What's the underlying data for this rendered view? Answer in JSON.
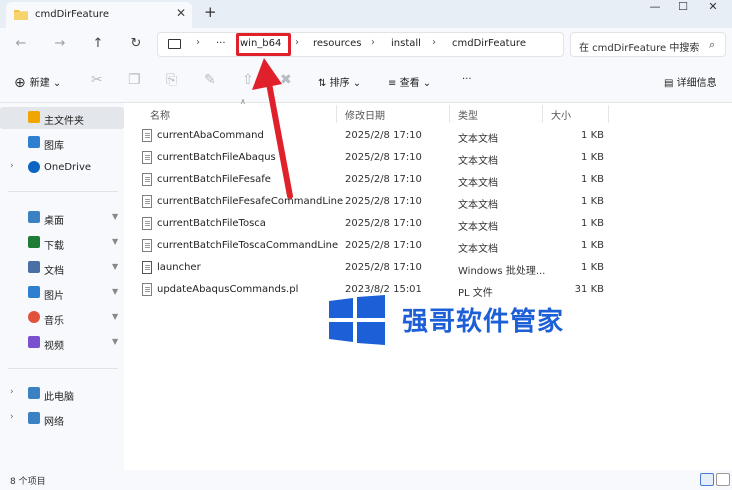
{
  "window": {
    "tab_title": "cmdDirFeature",
    "new_tab": "+",
    "tab_close": "✕",
    "minimize": "—",
    "maximize": "☐",
    "close": "✕"
  },
  "nav": {
    "back": "←",
    "forward": "→",
    "up": "↑",
    "refresh": "↻"
  },
  "address": {
    "overflow": "···",
    "segments": [
      "win_b64",
      "resources",
      "install",
      "cmdDirFeature"
    ]
  },
  "search": {
    "placeholder": "在 cmdDirFeature 中搜索"
  },
  "commandbar": {
    "new_label": "新建",
    "sort_label": "排序",
    "view_label": "查看",
    "more": "···",
    "details_label": "详细信息"
  },
  "sidebar": {
    "items": [
      {
        "label": "主文件夹",
        "icon": "home-icon",
        "color": "#f0a500"
      },
      {
        "label": "图库",
        "icon": "gallery-icon",
        "color": "#2f7fd1"
      },
      {
        "label": "OneDrive",
        "icon": "cloud-icon",
        "color": "#0a66c2"
      },
      {
        "label": "桌面",
        "icon": "desktop-icon",
        "color": "#3b82c4"
      },
      {
        "label": "下载",
        "icon": "download-icon",
        "color": "#1e7d34"
      },
      {
        "label": "文档",
        "icon": "document-icon",
        "color": "#4a6fa5"
      },
      {
        "label": "图片",
        "icon": "pictures-icon",
        "color": "#2f7fd1"
      },
      {
        "label": "音乐",
        "icon": "music-icon",
        "color": "#e2513b"
      },
      {
        "label": "视频",
        "icon": "video-icon",
        "color": "#7a4fd0"
      },
      {
        "label": "此电脑",
        "icon": "computer-icon",
        "color": "#3b82c4"
      },
      {
        "label": "网络",
        "icon": "network-icon",
        "color": "#3b82c4"
      }
    ]
  },
  "columns": {
    "name": "名称",
    "date": "修改日期",
    "type": "类型",
    "size": "大小"
  },
  "files": [
    {
      "name": "currentAbaCommand",
      "date": "2025/2/8 17:10",
      "type": "文本文档",
      "size": "1 KB"
    },
    {
      "name": "currentBatchFileAbaqus",
      "date": "2025/2/8 17:10",
      "type": "文本文档",
      "size": "1 KB"
    },
    {
      "name": "currentBatchFileFesafe",
      "date": "2025/2/8 17:10",
      "type": "文本文档",
      "size": "1 KB"
    },
    {
      "name": "currentBatchFileFesafeCommandLine",
      "date": "2025/2/8 17:10",
      "type": "文本文档",
      "size": "1 KB"
    },
    {
      "name": "currentBatchFileTosca",
      "date": "2025/2/8 17:10",
      "type": "文本文档",
      "size": "1 KB"
    },
    {
      "name": "currentBatchFileToscaCommandLine",
      "date": "2025/2/8 17:10",
      "type": "文本文档",
      "size": "1 KB"
    },
    {
      "name": "launcher",
      "date": "2025/2/8 17:10",
      "type": "Windows 批处理...",
      "size": "1 KB"
    },
    {
      "name": "updateAbaqusCommands.pl",
      "date": "2023/8/2 15:01",
      "type": "PL 文件",
      "size": "31 KB"
    }
  ],
  "watermark": {
    "text": "强哥软件管家",
    "color": "#1d5fd6"
  },
  "annotation": {
    "color": "#e0202a"
  },
  "status": {
    "item_count": "8 个项目"
  }
}
